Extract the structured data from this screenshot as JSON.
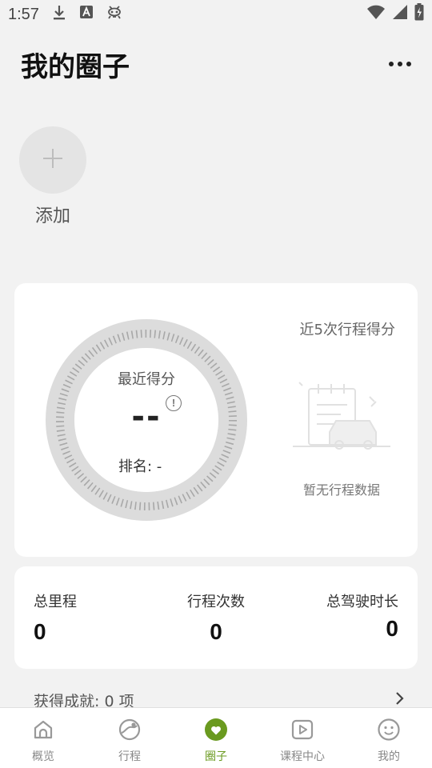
{
  "status_bar": {
    "time": "1:57"
  },
  "header": {
    "title": "我的圈子"
  },
  "add_member": {
    "label": "添加"
  },
  "score_card": {
    "gauge_label": "最近得分",
    "score": "--",
    "rank": "排名:  -",
    "recent_title": "近5次行程得分",
    "empty_text": "暂无行程数据"
  },
  "stats": [
    {
      "label": "总里程",
      "value": "0"
    },
    {
      "label": "行程次数",
      "value": "0"
    },
    {
      "label": "总驾驶时长",
      "value": "0"
    }
  ],
  "achievement": {
    "text": "获得成就:  0 项"
  },
  "tabs": [
    {
      "label": "概览",
      "icon": "home-icon"
    },
    {
      "label": "行程",
      "icon": "route-icon"
    },
    {
      "label": "圈子",
      "icon": "heart-icon",
      "active": true
    },
    {
      "label": "课程中心",
      "icon": "play-icon"
    },
    {
      "label": "我的",
      "icon": "smile-icon"
    }
  ],
  "colors": {
    "accent": "#6a9a1f",
    "background": "#f2f2f2",
    "card": "#ffffff"
  }
}
